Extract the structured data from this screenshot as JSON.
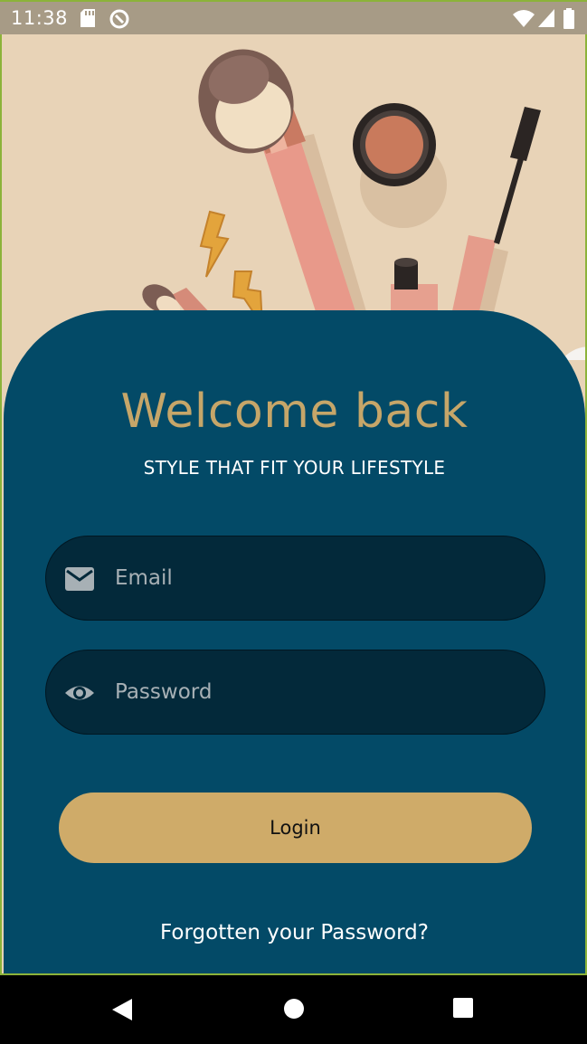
{
  "status_bar": {
    "time": "11:38",
    "icons": [
      "sd-card-icon",
      "data-saver-icon",
      "wifi-icon",
      "signal-icon",
      "battery-icon"
    ]
  },
  "hero": {
    "description_icons": [
      "powder-brush-icon",
      "blush-brush-icon",
      "compact-icon",
      "mascara-icon",
      "lipstick-icon",
      "earring-icon"
    ]
  },
  "login": {
    "title": "Welcome back",
    "tagline": "STYLE THAT FIT YOUR LIFESTYLE",
    "email_placeholder": "Email",
    "password_placeholder": "Password",
    "login_label": "Login",
    "forgot_label": "Forgotten your Password?"
  },
  "nav": {
    "buttons": [
      "back-icon",
      "home-icon",
      "recents-icon"
    ]
  },
  "colors": {
    "card": "#034a67",
    "field": "#03293a",
    "accent_gold": "#c6a669",
    "button": "#cfab69",
    "hero_bg": "#e8d3b7"
  }
}
